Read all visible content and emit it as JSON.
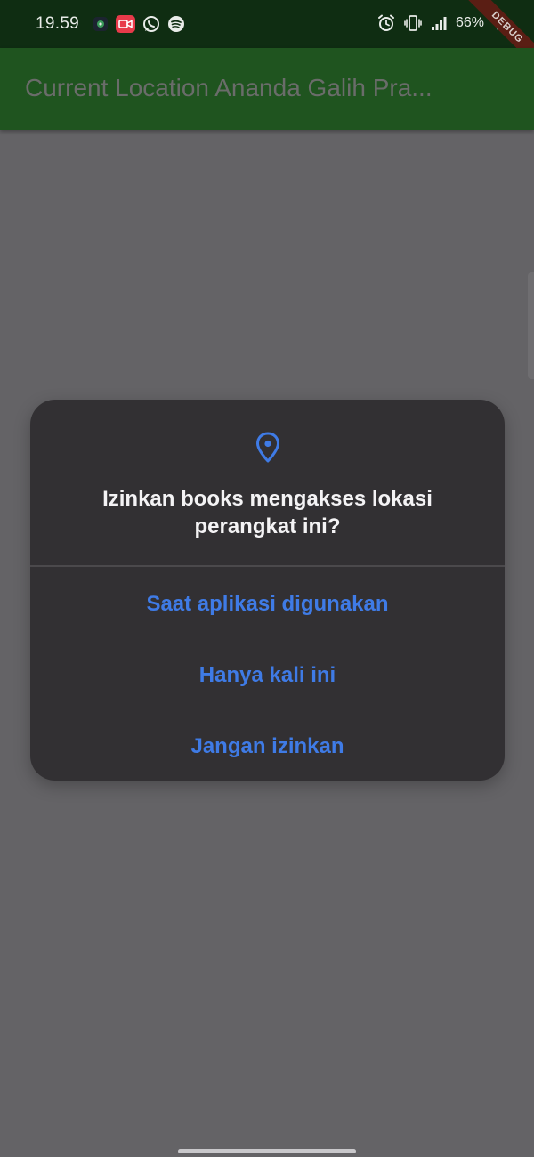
{
  "status_bar": {
    "time": "19.59",
    "battery": "66%",
    "left_icons": [
      "app-badge-icon",
      "video-record-icon",
      "whatsapp-icon",
      "spotify-icon"
    ],
    "right_icons": [
      "alarm-icon",
      "vibrate-icon",
      "signal-icon",
      "charging-icon"
    ]
  },
  "debug_banner": "DEBUG",
  "app_bar": {
    "title": "Current Location Ananda Galih Pra..."
  },
  "dialog": {
    "icon": "location-pin-icon",
    "title": "Izinkan books mengakses lokasi perangkat ini?",
    "options": [
      "Saat aplikasi digunakan",
      "Hanya kali ini",
      "Jangan izinkan"
    ]
  },
  "colors": {
    "accent": "#3f7be6",
    "app_bar": "#1f541f",
    "status_bar": "#0f2d12",
    "scrim": "#646366",
    "dialog_bg": "#323033"
  }
}
